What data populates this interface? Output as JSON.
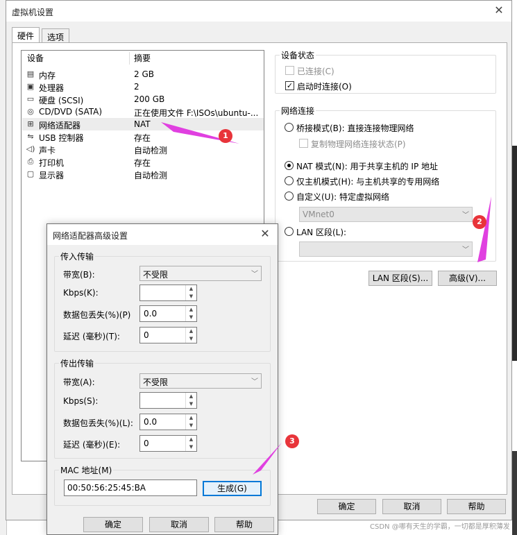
{
  "main_dialog": {
    "title": "虚拟机设置",
    "tabs": [
      "硬件",
      "选项"
    ],
    "device_list": {
      "headers": [
        "设备",
        "摘要"
      ],
      "rows": [
        {
          "name": "内存",
          "summary": "2 GB",
          "icon": "memory-icon"
        },
        {
          "name": "处理器",
          "summary": "2",
          "icon": "processor-icon"
        },
        {
          "name": "硬盘 (SCSI)",
          "summary": "200 GB",
          "icon": "hard-disk-icon"
        },
        {
          "name": "CD/DVD (SATA)",
          "summary": "正在使用文件 F:\\ISOs\\ubuntu-...",
          "icon": "cd-dvd-icon"
        },
        {
          "name": "网络适配器",
          "summary": "NAT",
          "icon": "network-adapter-icon"
        },
        {
          "name": "USB 控制器",
          "summary": "存在",
          "icon": "usb-icon"
        },
        {
          "name": "声卡",
          "summary": "自动检测",
          "icon": "speaker-icon"
        },
        {
          "name": "打印机",
          "summary": "存在",
          "icon": "printer-icon"
        },
        {
          "name": "显示器",
          "summary": "自动检测",
          "icon": "monitor-icon"
        }
      ]
    },
    "device_status": {
      "legend": "设备状态",
      "connected": "已连接(C)",
      "connect_on_power": "启动时连接(O)"
    },
    "network_connection": {
      "legend": "网络连接",
      "bridged": "桥接模式(B): 直接连接物理网络",
      "replicate": "复制物理网络连接状态(P)",
      "nat": "NAT 模式(N): 用于共享主机的 IP 地址",
      "host_only": "仅主机模式(H): 与主机共享的专用网络",
      "custom": "自定义(U): 特定虚拟网络",
      "vmnet_value": "VMnet0",
      "lan_segment": "LAN 区段(L):",
      "lan_segments_button": "LAN 区段(S)...",
      "advanced_button": "高级(V)..."
    },
    "buttons": {
      "ok": "确定",
      "cancel": "取消",
      "help": "帮助"
    }
  },
  "advanced_dialog": {
    "title": "网络适配器高级设置",
    "incoming": {
      "legend": "传入传输",
      "bandwidth_label": "带宽(B):",
      "bandwidth_value": "不受限",
      "kbps_label": "Kbps(K):",
      "kbps_value": "",
      "packet_loss_label": "数据包丢失(%)(P)",
      "packet_loss_value": "0.0",
      "latency_label": "延迟 (毫秒)(T):",
      "latency_value": "0"
    },
    "outgoing": {
      "legend": "传出传输",
      "bandwidth_label": "带宽(A):",
      "bandwidth_value": "不受限",
      "kbps_label": "Kbps(S):",
      "kbps_value": "",
      "packet_loss_label": "数据包丢失(%)(L):",
      "packet_loss_value": "0.0",
      "latency_label": "延迟 (毫秒)(E):",
      "latency_value": "0"
    },
    "mac": {
      "legend": "MAC 地址(M)",
      "value": "00:50:56:25:45:BA",
      "generate_button": "生成(G)"
    },
    "buttons": {
      "ok": "确定",
      "cancel": "取消",
      "help": "帮助"
    }
  },
  "annotations": [
    "1",
    "2",
    "3"
  ],
  "watermark": "CSDN @哪有天生的学霸，一切都是厚积薄发",
  "colors": {
    "arrow": "#e040e0",
    "badge": "#e8343a",
    "focus": "#0078d7"
  }
}
